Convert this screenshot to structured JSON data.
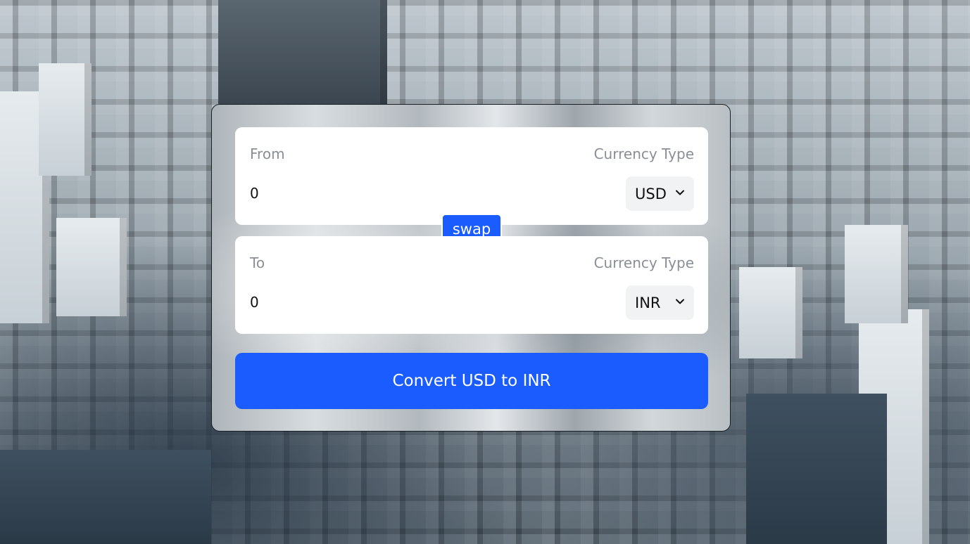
{
  "from": {
    "label": "From",
    "currency_type_label": "Currency Type",
    "amount": "0",
    "currency": "USD"
  },
  "to": {
    "label": "To",
    "currency_type_label": "Currency Type",
    "amount": "0",
    "currency": "INR"
  },
  "swap_label": "swap",
  "convert_label": "Convert USD to INR",
  "colors": {
    "accent": "#1a5cff",
    "panel": "#ffffff",
    "select_bg": "#f1f2f4",
    "muted_text": "#8a8f95"
  },
  "icons": {
    "select_caret": "chevron-down-icon"
  }
}
